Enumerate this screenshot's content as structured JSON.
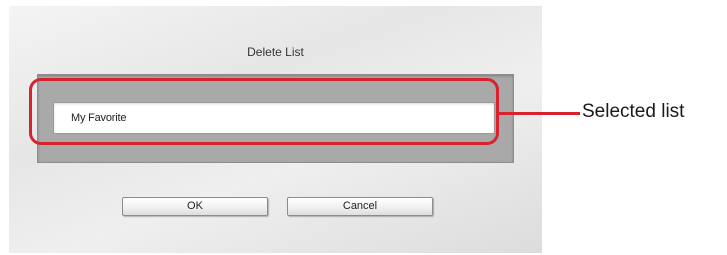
{
  "dialog": {
    "title": "Delete List",
    "selected_list": "My Favorite",
    "buttons": {
      "ok": "OK",
      "cancel": "Cancel"
    }
  },
  "annotation": {
    "label": "Selected list",
    "color": "#d8232e"
  }
}
